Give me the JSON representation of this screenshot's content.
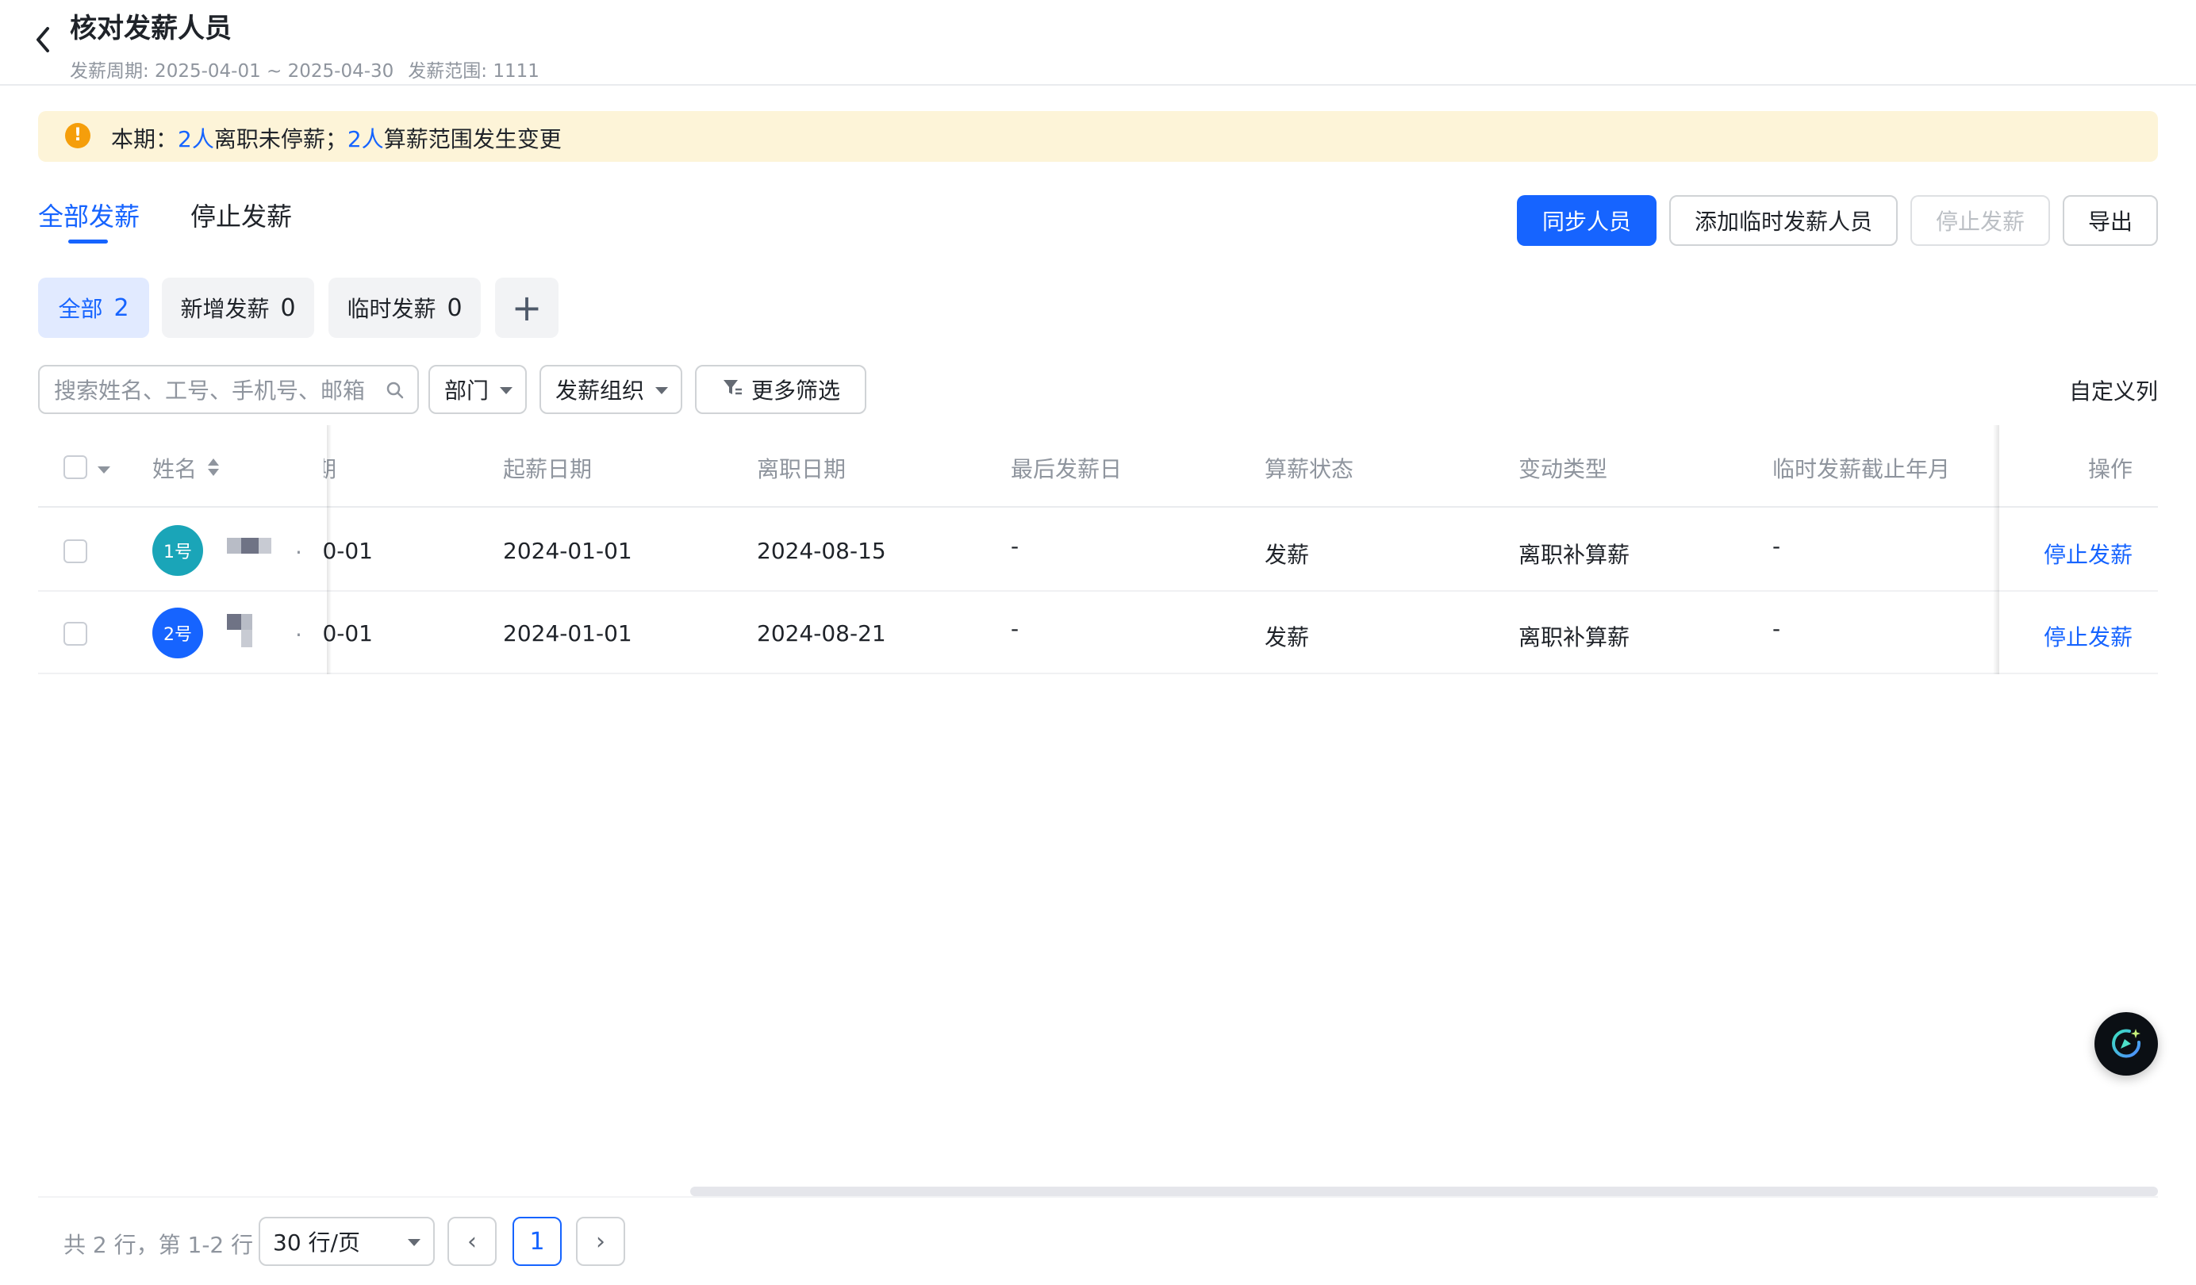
{
  "header": {
    "title": "核对发薪人员",
    "period": "发薪周期: 2025-04-01 ~ 2025-04-30",
    "scope": "发薪范围: 1111"
  },
  "notice": {
    "prefix": "本期：",
    "count1": "2人",
    "text1": "离职未停薪；",
    "count2": "2人",
    "text2": "算薪范围发生变更"
  },
  "tabs": [
    {
      "label": "全部发薪",
      "active": true
    },
    {
      "label": "停止发薪",
      "active": false
    }
  ],
  "actions": {
    "sync": "同步人员",
    "add_temp": "添加临时发薪人员",
    "stop": "停止发薪",
    "export": "导出"
  },
  "chips": [
    {
      "label": "全部",
      "count": "2"
    },
    {
      "label": "新增发薪",
      "count": "0"
    },
    {
      "label": "临时发薪",
      "count": "0"
    }
  ],
  "chip_add": "+",
  "filters": {
    "search_placeholder": "搜索姓名、工号、手机号、邮箱",
    "dept": "部门",
    "org": "发薪组织",
    "more": "更多筛选",
    "custom_columns": "自定义列"
  },
  "table": {
    "columns": {
      "name": "姓名",
      "partial": "期",
      "start_date": "起薪日期",
      "leave_date": "离职日期",
      "last_pay": "最后发薪日",
      "status": "算薪状态",
      "change_type": "变动类型",
      "temp_deadline": "临时发薪截止年月",
      "ops": "操作"
    },
    "rows": [
      {
        "avatar": "1号",
        "trunc": ".",
        "partial_date": "0-01",
        "start_date": "2024-01-01",
        "leave_date": "2024-08-15",
        "last_pay": "-",
        "status": "发薪",
        "change_type": "离职补算薪",
        "temp_deadline": "-",
        "op": "停止发薪"
      },
      {
        "avatar": "2号",
        "trunc": ".",
        "partial_date": "0-01",
        "start_date": "2024-01-01",
        "leave_date": "2024-08-21",
        "last_pay": "-",
        "status": "发薪",
        "change_type": "离职补算薪",
        "temp_deadline": "-",
        "op": "停止发薪"
      }
    ]
  },
  "pagination": {
    "total": "共 2 行，第 1-2 行",
    "page_size": "30 行/页",
    "prev": "‹",
    "current": "1",
    "next": "›"
  },
  "colors": {
    "primary": "#1664ff",
    "notice_bg": "#fdf4d8",
    "warning": "#f59e0b",
    "avatar1": "#1aa5b8",
    "avatar2": "#1664ff"
  },
  "icons": [
    "back-chevron-icon",
    "warning-icon",
    "search-icon",
    "filter-icon",
    "sort-icon",
    "assistant-icon"
  ]
}
